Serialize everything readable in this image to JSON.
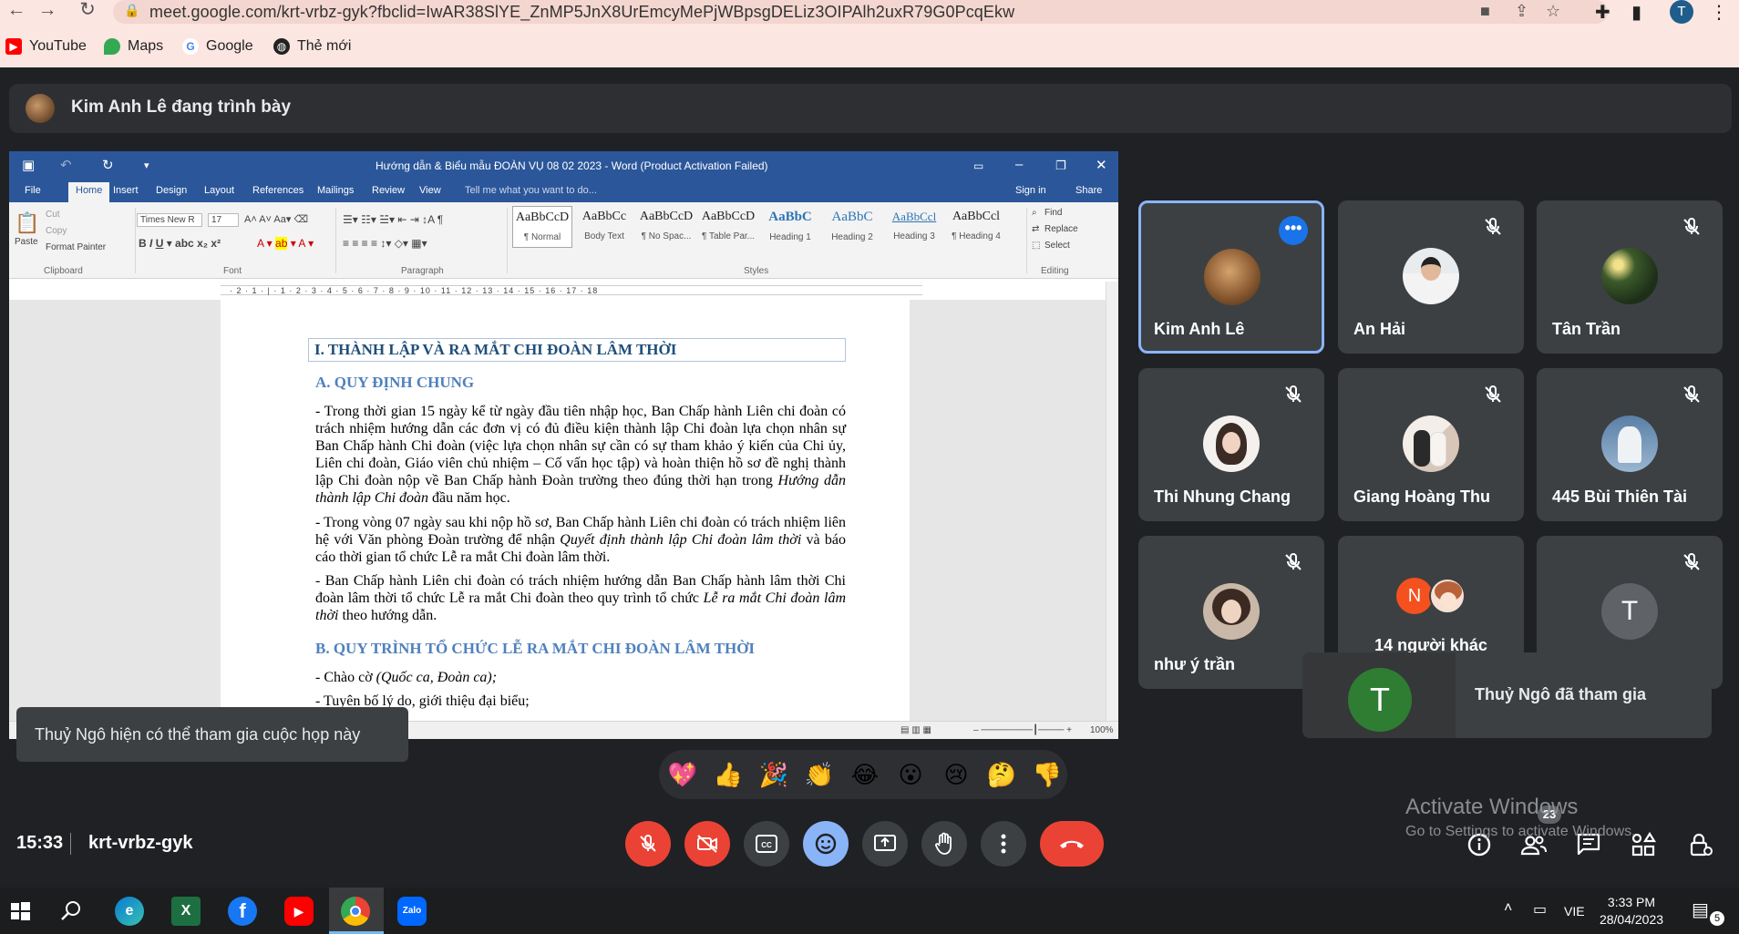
{
  "browser": {
    "url": "meet.google.com/krt-vrbz-gyk?fbclid=IwAR38SlYE_ZnMP5JnX8UrEmcyMePjWBpsgDELiz3OIPAlh2uxR79G0PcqEkw",
    "profile_initial": "T",
    "bookmarks": [
      {
        "label": "YouTube",
        "icon": "youtube-icon",
        "color": "#ff0000"
      },
      {
        "label": "Maps",
        "icon": "maps-icon",
        "color": "#34a853"
      },
      {
        "label": "Google",
        "icon": "google-icon",
        "color": "#4285f4"
      },
      {
        "label": "Thẻ mới",
        "icon": "globe-icon",
        "color": "#222222"
      }
    ]
  },
  "meet": {
    "presenter_text": "Kim Anh Lê đang trình bày",
    "time": "15:33",
    "meeting_code": "krt-vrbz-gyk",
    "participants": [
      {
        "name": "Kim Anh Lê",
        "muted": false,
        "active": true
      },
      {
        "name": "An Hải",
        "muted": true
      },
      {
        "name": "Tân Trần",
        "muted": true
      },
      {
        "name": "Thi Nhung Chang",
        "muted": true
      },
      {
        "name": "Giang Hoàng Thu",
        "muted": true
      },
      {
        "name": "445 Bùi Thiên Tài",
        "muted": true
      },
      {
        "name": "như ý trần",
        "muted": true
      },
      {
        "name": "14 người khác",
        "muted": false
      },
      {
        "name": "",
        "muted": true
      }
    ],
    "others_initial": "N",
    "tile9_initial": "T",
    "join_toast": {
      "initial": "T",
      "text": "Thuỷ Ngô đã tham gia"
    },
    "can_join_toast": "Thuỷ Ngô hiện có thể tham gia cuộc họp này",
    "people_count": "23",
    "reactions": [
      "💖",
      "👍",
      "🎉",
      "👏",
      "😂",
      "😮",
      "😢",
      "🤔",
      "👎"
    ],
    "accent_red": "#ea4335",
    "accent_blue": "#8ab4f8"
  },
  "word": {
    "title": "Hướng dẫn & Biểu mẫu ĐOÀN VỤ 08 02 2023 - Word (Product Activation Failed)",
    "tabs": [
      "File",
      "Home",
      "Insert",
      "Design",
      "Layout",
      "References",
      "Mailings",
      "Review",
      "View"
    ],
    "tell_me": "Tell me what you want to do...",
    "sign_in": "Sign in",
    "share": "Share",
    "clipboard": {
      "paste": "Paste",
      "cut": "Cut",
      "copy": "Copy",
      "format_painter": "Format Painter",
      "group": "Clipboard"
    },
    "font": {
      "name": "Times New R",
      "size": "17",
      "group": "Font"
    },
    "paragraph_group": "Paragraph",
    "styles": [
      {
        "sample": "AaBbCcD",
        "name": "¶ Normal"
      },
      {
        "sample": "AaBbCc",
        "name": "Body Text"
      },
      {
        "sample": "AaBbCcD",
        "name": "¶ No Spac..."
      },
      {
        "sample": "AaBbCcD",
        "name": "¶ Table Par..."
      },
      {
        "sample": "AaBbC",
        "name": "Heading 1"
      },
      {
        "sample": "AaBbC",
        "name": "Heading 2"
      },
      {
        "sample": "AaBbCcl",
        "name": "Heading 3"
      },
      {
        "sample": "AaBbCcl",
        "name": "¶ Heading 4"
      }
    ],
    "styles_group": "Styles",
    "editing": {
      "find": "Find",
      "replace": "Replace",
      "select": "Select",
      "group": "Editing"
    },
    "ruler": "· 2 · 1 · | · 1 · 2 · 3 · 4 · 5 · 6 · 7 · 8 · 9 · 10 · 11 · 12 · 13 · 14 · 15 · 16 · 17 · 18",
    "zoom": "100%",
    "doc": {
      "h1": "I. THÀNH LẬP VÀ RA MẮT CHI ĐOÀN LÂM THỜI",
      "hA": "A. QUY ĐỊNH CHUNG",
      "p1": "- Trong thời gian 15 ngày kể từ ngày đầu tiên nhập học, Ban Chấp hành Liên chi đoàn có trách nhiệm hướng dẫn các đơn vị có đủ điều kiện thành lập Chi đoàn lựa chọn nhân sự Ban Chấp hành Chi đoàn (việc lựa chọn nhân sự cần có sự tham khảo ý kiến của Chi ủy, Liên chi đoàn, Giáo viên chủ nhiệm – Cố vấn học tập) và hoàn thiện hồ sơ đề nghị thành lập Chi đoàn nộp về Ban Chấp hành Đoàn trường theo đúng thời hạn trong",
      "p1_italic": "Hướng dẫn thành lập Chi đoàn",
      "p1_end": " đầu năm học.",
      "p2": "- Trong vòng 07 ngày sau khi nộp hồ sơ, Ban Chấp hành Liên chi đoàn có trách nhiệm liên hệ với Văn phòng Đoàn trường để nhận ",
      "p2_italic": "Quyết định thành lập Chi đoàn lâm thời",
      "p2_end": " và báo cáo thời gian tổ chức Lễ ra mắt Chi đoàn lâm thời.",
      "p3": "- Ban Chấp hành Liên chi đoàn có trách nhiệm hướng dẫn Ban Chấp hành lâm thời Chi đoàn lâm thời tổ chức Lễ ra mắt Chi đoàn theo quy trình tổ chức ",
      "p3_italic": "Lễ ra mắt Chi đoàn lâm thời",
      "p3_end": " theo hướng dẫn.",
      "hB": "B. QUY TRÌNH TỔ CHỨC LỄ RA MẮT CHI ĐOÀN LÂM THỜI",
      "b1": "- Chào cờ ",
      "b1_italic": "(Quốc ca, Đoàn ca);",
      "b2": "- Tuyên bố lý do, giới thiệu đại biểu;"
    }
  },
  "windows": {
    "activate_title": "Activate Windows",
    "activate_sub": "Go to Settings to activate Windows.",
    "lang": "VIE",
    "time": "3:33 PM",
    "date": "28/04/2023",
    "notifications": "5",
    "taskbar_apps": [
      "start-icon",
      "search-icon",
      "edge-icon",
      "excel-icon",
      "facebook-icon",
      "youtube-icon",
      "chrome-icon",
      "zalo-icon"
    ]
  }
}
